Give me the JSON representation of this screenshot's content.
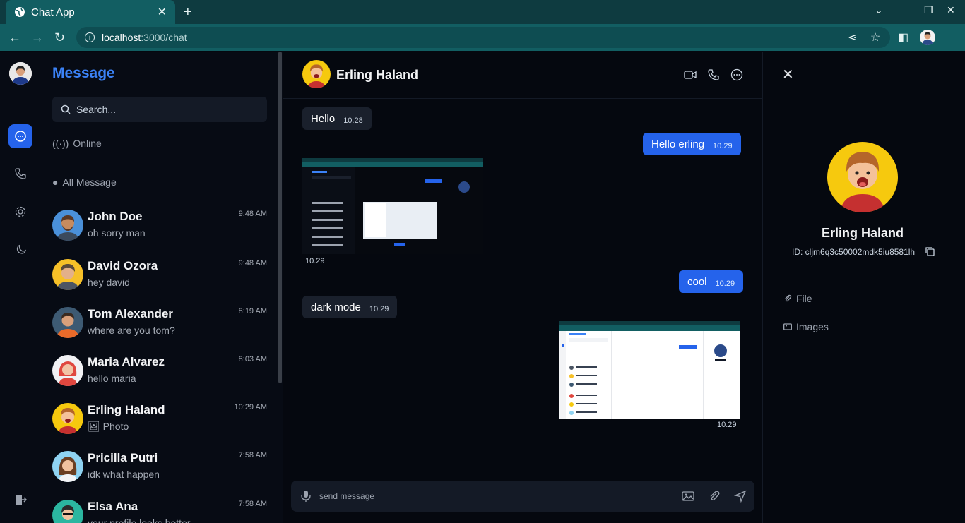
{
  "browser": {
    "tab_title": "Chat App",
    "url_host": "localhost",
    "url_path": ":3000/chat"
  },
  "sidebar": {
    "heading": "Message",
    "search_placeholder": "Search...",
    "online_label": "Online",
    "all_label": "All Message",
    "chats": [
      {
        "name": "John Doe",
        "last": "oh sorry man",
        "time": "9:48 AM"
      },
      {
        "name": "David Ozora",
        "last": "hey david",
        "time": "9:48 AM"
      },
      {
        "name": "Tom Alexander",
        "last": "where are you tom?",
        "time": "8:19 AM"
      },
      {
        "name": "Maria Alvarez",
        "last": "hello maria",
        "time": "8:03 AM"
      },
      {
        "name": "Erling Haland",
        "last": "Photo",
        "time": "10:29 AM"
      },
      {
        "name": "Pricilla Putri",
        "last": "idk what happen",
        "time": "7:58 AM"
      },
      {
        "name": "Elsa Ana",
        "last": "your profile looks better",
        "time": "7:58 AM"
      }
    ]
  },
  "chat": {
    "contact_name": "Erling Haland",
    "messages": [
      {
        "text": "Hello",
        "time": "10.28"
      },
      {
        "text": "Hello erling",
        "time": "10.29"
      },
      {
        "image_time": "10.29"
      },
      {
        "text": "cool",
        "time": "10.29"
      },
      {
        "text": "dark mode",
        "time": "10.29"
      },
      {
        "image_time": "10.29"
      }
    ],
    "composer_placeholder": "send message"
  },
  "detail": {
    "name": "Erling Haland",
    "id_text": "ID: cljm6q3c50002mdk5iu8581lh",
    "file_label": "File",
    "images_label": "Images"
  },
  "colors": {
    "accent": "#2563eb",
    "tab_bar": "#0e3b40",
    "address_bar": "#125e62",
    "background": "#05080f"
  }
}
